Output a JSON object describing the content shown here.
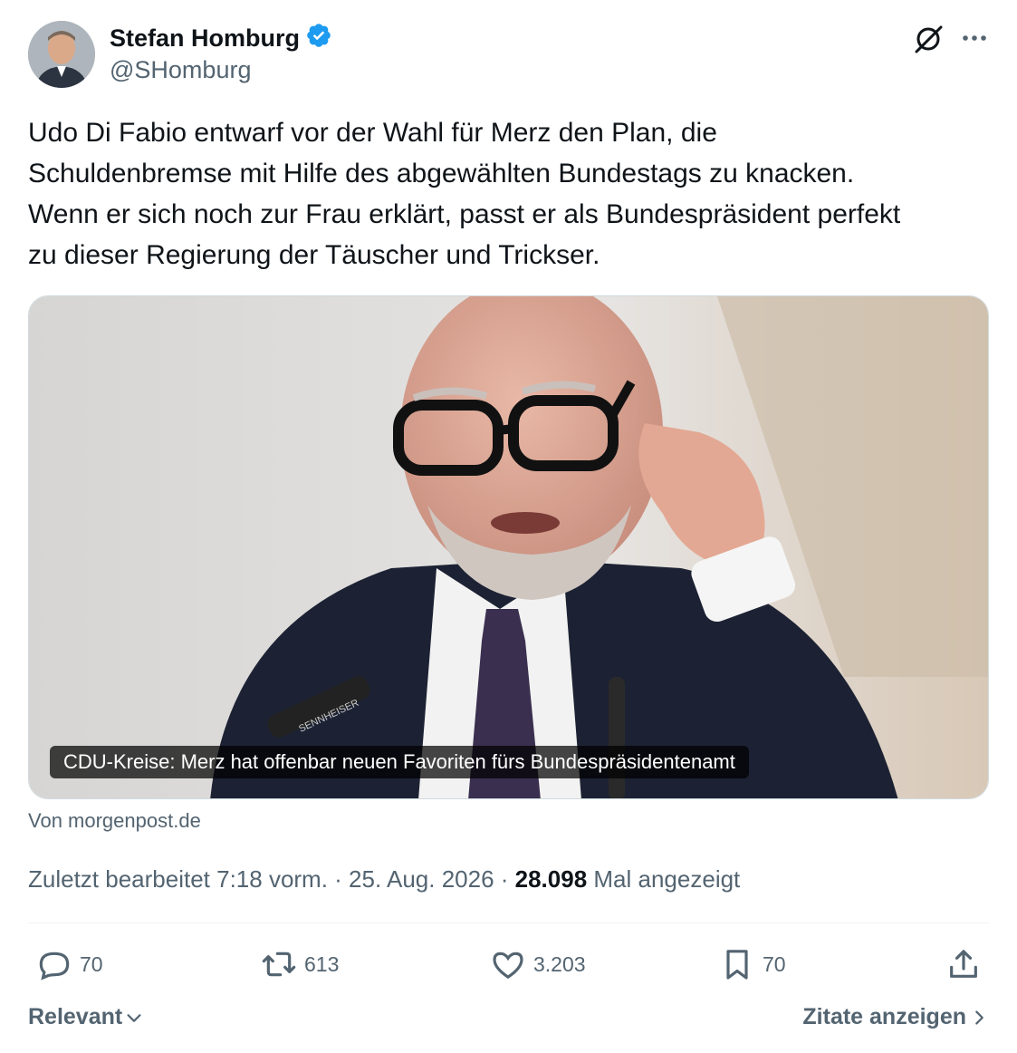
{
  "author": {
    "name": "Stefan Homburg",
    "handle": "@SHomburg",
    "verified_color": "#1d9bf0"
  },
  "icons": {
    "verified": "verified-badge-icon",
    "grok": "grok-icon",
    "more": "more-dots-icon",
    "reply": "reply-icon",
    "retweet": "retweet-icon",
    "like": "heart-icon",
    "bookmark": "bookmark-icon",
    "share": "share-icon"
  },
  "tweet": {
    "text": "Udo Di Fabio entwarf vor der Wahl für Merz den Plan, die\nSchuldenbremse mit Hilfe des abgewählten Bundestags zu knacken.\nWenn er sich noch zur Frau erklärt, passt er als Bundespräsident perfekt\nzu dieser Regierung der Täuscher und Trickser."
  },
  "card": {
    "title": "CDU-Kreise: Merz hat offenbar neuen Favoriten fürs Bundespräsidentenamt",
    "source": "Von morgenpost.de",
    "image_text": "SENNHEISER"
  },
  "meta": {
    "edited": "Zuletzt bearbeitet 7:18 vorm. · 25. Aug. 2026 · ",
    "views": "28.098",
    "views_label": " Mal angezeigt"
  },
  "actions": {
    "replies": "70",
    "retweets": "613",
    "likes": "3.203",
    "bookmarks": "70"
  },
  "footer": {
    "sort": "Relevant",
    "quotes": "Zitate anzeigen"
  },
  "colors": {
    "text": "#0f1419",
    "secondary": "#536471",
    "accent": "#1d9bf0"
  }
}
